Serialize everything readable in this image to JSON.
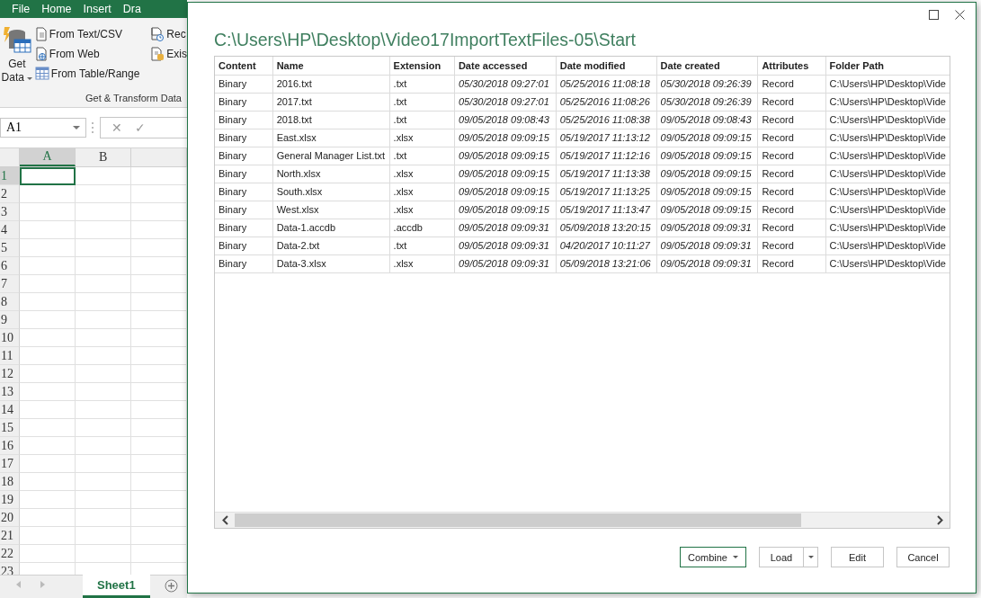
{
  "ribbon": {
    "tabs": [
      {
        "label": "File",
        "selected": false
      },
      {
        "label": "Home",
        "selected": false
      },
      {
        "label": "Insert",
        "selected": false
      },
      {
        "label": "Dra",
        "selected": false
      }
    ],
    "get_data": {
      "line1": "Get",
      "line2": "Data"
    },
    "commands": [
      {
        "label": "From Text/CSV",
        "kind": "text"
      },
      {
        "label": "From Web",
        "kind": "web"
      },
      {
        "label": "From Table/Range",
        "kind": "table"
      }
    ],
    "commands_2": [
      {
        "label": "Rec",
        "kind": "recent"
      },
      {
        "label": "Exis",
        "kind": "existing"
      }
    ],
    "group_label": "Get & Transform Data"
  },
  "formula_bar": {
    "name_box": "A1",
    "cancel": "✕",
    "enter": "✓"
  },
  "sheet": {
    "columns": [
      {
        "label": "A",
        "selected": true
      },
      {
        "label": "B",
        "selected": false
      }
    ],
    "rows": [
      {
        "label": "1",
        "selected": true
      },
      {
        "label": "2",
        "selected": false
      },
      {
        "label": "3",
        "selected": false
      },
      {
        "label": "4",
        "selected": false
      },
      {
        "label": "5",
        "selected": false
      },
      {
        "label": "6",
        "selected": false
      },
      {
        "label": "7",
        "selected": false
      },
      {
        "label": "8",
        "selected": false
      },
      {
        "label": "9",
        "selected": false
      },
      {
        "label": "10",
        "selected": false
      },
      {
        "label": "11",
        "selected": false
      },
      {
        "label": "12",
        "selected": false
      },
      {
        "label": "13",
        "selected": false
      },
      {
        "label": "14",
        "selected": false
      },
      {
        "label": "15",
        "selected": false
      },
      {
        "label": "16",
        "selected": false
      },
      {
        "label": "17",
        "selected": false
      },
      {
        "label": "18",
        "selected": false
      },
      {
        "label": "19",
        "selected": false
      },
      {
        "label": "20",
        "selected": false
      },
      {
        "label": "21",
        "selected": false
      },
      {
        "label": "22",
        "selected": false
      },
      {
        "label": "23",
        "selected": false
      }
    ],
    "tabs": [
      {
        "label": "Sheet1",
        "selected": true
      }
    ]
  },
  "dialog": {
    "title": "C:\\Users\\HP\\Desktop\\Video17ImportTextFiles-05\\Start",
    "table": {
      "columns": [
        "Content",
        "Name",
        "Extension",
        "Date accessed",
        "Date modified",
        "Date created",
        "Attributes",
        "Folder Path"
      ],
      "rows": [
        [
          "Binary",
          "2016.txt",
          ".txt",
          "05/30/2018 09:27:01",
          "05/25/2016 11:08:18",
          "05/30/2018 09:26:39",
          "Record",
          "C:\\Users\\HP\\Desktop\\Vide"
        ],
        [
          "Binary",
          "2017.txt",
          ".txt",
          "05/30/2018 09:27:01",
          "05/25/2016 11:08:26",
          "05/30/2018 09:26:39",
          "Record",
          "C:\\Users\\HP\\Desktop\\Vide"
        ],
        [
          "Binary",
          "2018.txt",
          ".txt",
          "09/05/2018 09:08:43",
          "05/25/2016 11:08:38",
          "09/05/2018 09:08:43",
          "Record",
          "C:\\Users\\HP\\Desktop\\Vide"
        ],
        [
          "Binary",
          "East.xlsx",
          ".xlsx",
          "09/05/2018 09:09:15",
          "05/19/2017 11:13:12",
          "09/05/2018 09:09:15",
          "Record",
          "C:\\Users\\HP\\Desktop\\Vide"
        ],
        [
          "Binary",
          "General Manager List.txt",
          ".txt",
          "09/05/2018 09:09:15",
          "05/19/2017 11:12:16",
          "09/05/2018 09:09:15",
          "Record",
          "C:\\Users\\HP\\Desktop\\Vide"
        ],
        [
          "Binary",
          "North.xlsx",
          ".xlsx",
          "09/05/2018 09:09:15",
          "05/19/2017 11:13:38",
          "09/05/2018 09:09:15",
          "Record",
          "C:\\Users\\HP\\Desktop\\Vide"
        ],
        [
          "Binary",
          "South.xlsx",
          ".xlsx",
          "09/05/2018 09:09:15",
          "05/19/2017 11:13:25",
          "09/05/2018 09:09:15",
          "Record",
          "C:\\Users\\HP\\Desktop\\Vide"
        ],
        [
          "Binary",
          "West.xlsx",
          ".xlsx",
          "09/05/2018 09:09:15",
          "05/19/2017 11:13:47",
          "09/05/2018 09:09:15",
          "Record",
          "C:\\Users\\HP\\Desktop\\Vide"
        ],
        [
          "Binary",
          "Data-1.accdb",
          ".accdb",
          "09/05/2018 09:09:31",
          "05/09/2018 13:20:15",
          "09/05/2018 09:09:31",
          "Record",
          "C:\\Users\\HP\\Desktop\\Vide"
        ],
        [
          "Binary",
          "Data-2.txt",
          ".txt",
          "09/05/2018 09:09:31",
          "04/20/2017 10:11:27",
          "09/05/2018 09:09:31",
          "Record",
          "C:\\Users\\HP\\Desktop\\Vide"
        ],
        [
          "Binary",
          "Data-3.xlsx",
          ".xlsx",
          "09/05/2018 09:09:31",
          "05/09/2018 13:21:06",
          "09/05/2018 09:09:31",
          "Record",
          "C:\\Users\\HP\\Desktop\\Vide"
        ]
      ]
    },
    "buttons": [
      {
        "label": "Combine",
        "kind": "dropdown",
        "default": true
      },
      {
        "label": "Load",
        "kind": "split",
        "default": false
      },
      {
        "label": "Edit",
        "kind": "plain",
        "default": false
      },
      {
        "label": "Cancel",
        "kind": "plain",
        "default": false
      }
    ]
  }
}
